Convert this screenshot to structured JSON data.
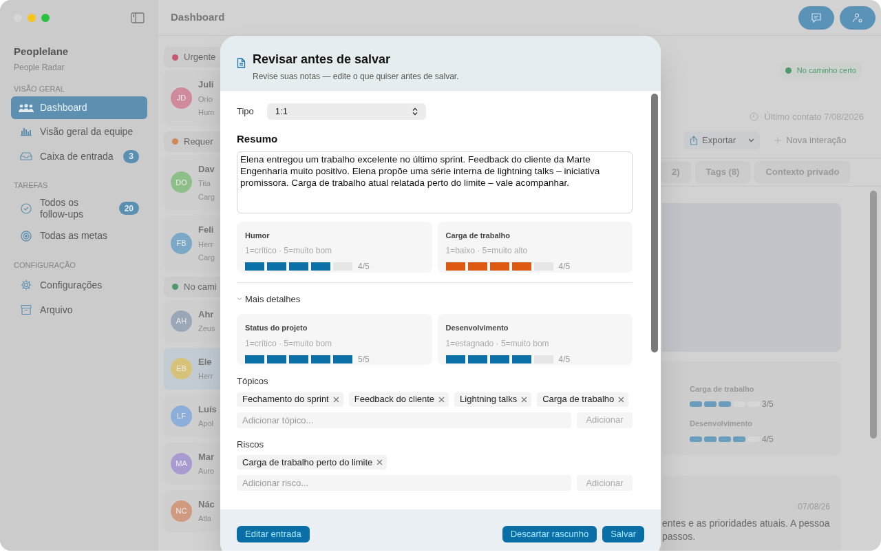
{
  "window": {
    "title": "Dashboard"
  },
  "sidebar": {
    "app_name": "Peoplelane",
    "app_subtitle": "People Radar",
    "sections": [
      {
        "heading": "VISÃO GERAL",
        "items": [
          {
            "kind": "people",
            "label": "Dashboard",
            "selected": true
          },
          {
            "kind": "chart",
            "label": "Visão geral da equipe",
            "selected": false
          },
          {
            "kind": "inbox",
            "label": "Caixa de entrada",
            "badge": "3",
            "selected": false
          }
        ]
      },
      {
        "heading": "TAREFAS",
        "items": [
          {
            "kind": "check",
            "label": "Todos os follow-ups",
            "badge": "20",
            "selected": false
          },
          {
            "kind": "target",
            "label": "Todas as metas",
            "selected": false
          }
        ]
      },
      {
        "heading": "CONFIGURAÇÃO",
        "items": [
          {
            "kind": "gear",
            "label": "Configurações",
            "selected": false
          },
          {
            "kind": "archive",
            "label": "Arquivo",
            "selected": false
          }
        ]
      }
    ]
  },
  "list": {
    "groups": [
      {
        "label": "Urgente",
        "color": "#c4566e",
        "people": [
          {
            "initials": "JD",
            "color": "#cf8a9c",
            "name": "Juli",
            "lines": [
              "Orio",
              "Hum"
            ],
            "selected": false
          }
        ]
      },
      {
        "label": "Requer",
        "color": "#d08a5a",
        "people": [
          {
            "initials": "DO",
            "color": "#8ebf8a",
            "name": "Dav",
            "lines": [
              "Tita",
              "Carg"
            ],
            "selected": false
          },
          {
            "initials": "FB",
            "color": "#7aa8c6",
            "name": "Feli",
            "lines": [
              "Herr",
              "Carg"
            ],
            "selected": false
          }
        ]
      },
      {
        "label": "No cami",
        "color": "#4f9a6c",
        "people": [
          {
            "initials": "AH",
            "color": "#9aa7b6",
            "name": "Ahr",
            "lines": [
              "Zeus"
            ],
            "selected": false
          },
          {
            "initials": "EB",
            "color": "#d7c27a",
            "name": "Ele",
            "lines": [
              "Herr"
            ],
            "selected": true
          },
          {
            "initials": "LF",
            "color": "#8daed8",
            "name": "Luís",
            "lines": [
              "Apol"
            ],
            "selected": false
          },
          {
            "initials": "MA",
            "color": "#a99ad0",
            "name": "Mar",
            "lines": [
              "Auro"
            ],
            "selected": false
          },
          {
            "initials": "NC",
            "color": "#cf9a80",
            "name": "Nác",
            "lines": [
              "Atla"
            ],
            "selected": false
          }
        ]
      }
    ]
  },
  "detail": {
    "status": {
      "label": "No caminho certo",
      "color": "#4f9a6c"
    },
    "last_contact": "Último contato 7/08/2026",
    "actions": [
      {
        "kind": "export",
        "label": "Exportar",
        "disabled": false
      },
      {
        "kind": "new",
        "label": "Nova interação",
        "disabled": true
      }
    ],
    "tabs": [
      {
        "label": "2)",
        "selected": false
      },
      {
        "label": "Tags (8)",
        "selected": false
      },
      {
        "label": "Contexto privado",
        "selected": false
      }
    ],
    "ratings": [
      {
        "label": "Carga de trabalho",
        "level": 0.6,
        "reading": "3/5"
      },
      {
        "label": "Desenvolvimento",
        "level": 0.8,
        "reading": "4/5"
      }
    ],
    "entry": {
      "date": "07/08/26",
      "lines": [
        "entes e as prioridades atuais. A pessoa",
        "passos."
      ]
    }
  },
  "modal": {
    "title": "Revisar antes de salvar",
    "subtitle": "Revise suas notas — edite o que quiser antes de salvar.",
    "type": {
      "label": "Tipo",
      "value": "1:1"
    },
    "summary": {
      "label": "Resumo",
      "value": "Elena entregou um trabalho excelente no último sprint. Feedback do cliente da Marte Engenharia muito positivo. Elena propõe uma série interna de lightning talks – iniciativa promissora. Carga de trabalho atual relatada perto do limite – vale acompanhar."
    },
    "ratings": [
      {
        "label": "Humor",
        "scale": "1=crítico · 5=muito bom",
        "level": 0.8,
        "reading": "4/5",
        "color": "#0b6fa8"
      },
      {
        "label": "Carga de trabalho",
        "scale": "1=baixo · 5=muito alto",
        "level": 0.8,
        "reading": "4/5",
        "color": "#dc5a12"
      }
    ],
    "details": {
      "label": "Mais detalhes",
      "expanded": true,
      "ratings": [
        {
          "label": "Status do projeto",
          "scale": "1=crítico · 5=muito bom",
          "level": 1,
          "reading": "5/5",
          "color": "#0b6fa8"
        },
        {
          "label": "Desenvolvimento",
          "scale": "1=estagnado · 5=muito bom",
          "level": 0.8,
          "reading": "4/5",
          "color": "#0b6fa8"
        }
      ]
    },
    "topics": {
      "label": "Tópicos",
      "tags": [
        "Fechamento do sprint",
        "Feedback do cliente",
        "Lightning talks",
        "Carga de trabalho"
      ],
      "placeholder": "Adicionar tópico...",
      "add": "Adicionar"
    },
    "risks": {
      "label": "Riscos",
      "tags": [
        "Carga de trabalho perto do limite"
      ],
      "placeholder": "Adicionar risco...",
      "add": "Adicionar"
    },
    "footer": {
      "left": "Editar entrada",
      "right": [
        "Descartar rascunho",
        "Salvar"
      ]
    }
  }
}
